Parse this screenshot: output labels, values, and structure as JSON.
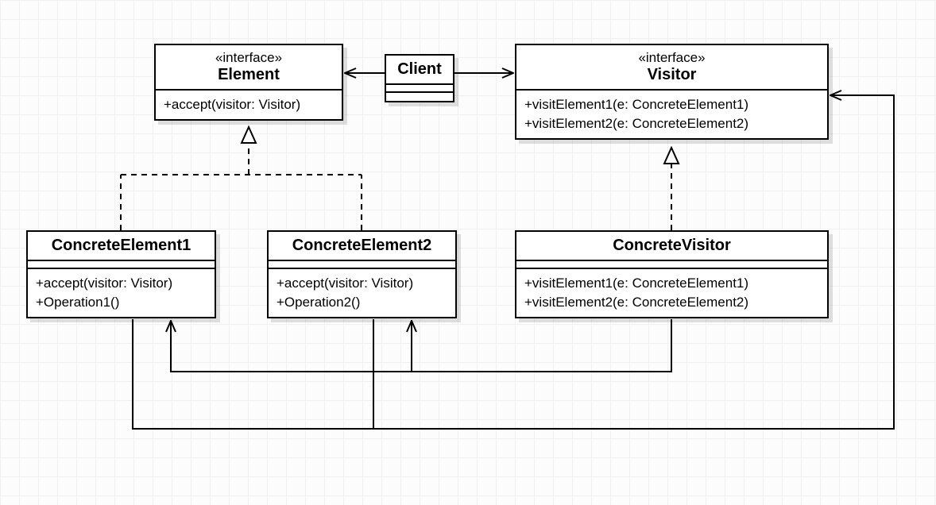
{
  "diagram_type": "UML class diagram — Visitor pattern",
  "boxes": {
    "element": {
      "stereotype": "«interface»",
      "name": "Element",
      "ops": [
        "+accept(visitor: Visitor)"
      ]
    },
    "client": {
      "name": "Client"
    },
    "visitor": {
      "stereotype": "«interface»",
      "name": "Visitor",
      "ops": [
        "+visitElement1(e: ConcreteElement1)",
        "+visitElement2(e: ConcreteElement2)"
      ]
    },
    "concreteElement1": {
      "name": "ConcreteElement1",
      "ops": [
        "+accept(visitor: Visitor)",
        "+Operation1()"
      ]
    },
    "concreteElement2": {
      "name": "ConcreteElement2",
      "ops": [
        "+accept(visitor: Visitor)",
        "+Operation2()"
      ]
    },
    "concreteVisitor": {
      "name": "ConcreteVisitor",
      "ops": [
        "+visitElement1(e: ConcreteElement1)",
        "+visitElement2(e: ConcreteElement2)"
      ]
    }
  },
  "connectors": [
    {
      "from": "client",
      "to": "element",
      "type": "association-arrow"
    },
    {
      "from": "client",
      "to": "visitor",
      "type": "association-arrow"
    },
    {
      "from": "concreteElement1",
      "to": "element",
      "type": "realization"
    },
    {
      "from": "concreteElement2",
      "to": "element",
      "type": "realization"
    },
    {
      "from": "concreteVisitor",
      "to": "visitor",
      "type": "realization"
    },
    {
      "from": "concreteVisitor",
      "to": "concreteElement1",
      "type": "association-arrow"
    },
    {
      "from": "concreteVisitor",
      "to": "concreteElement2",
      "type": "association-arrow"
    },
    {
      "from": "concreteElement1",
      "to": "visitor",
      "type": "association-arrow"
    },
    {
      "from": "concreteElement2",
      "to": "visitor",
      "type": "association-arrow"
    }
  ]
}
